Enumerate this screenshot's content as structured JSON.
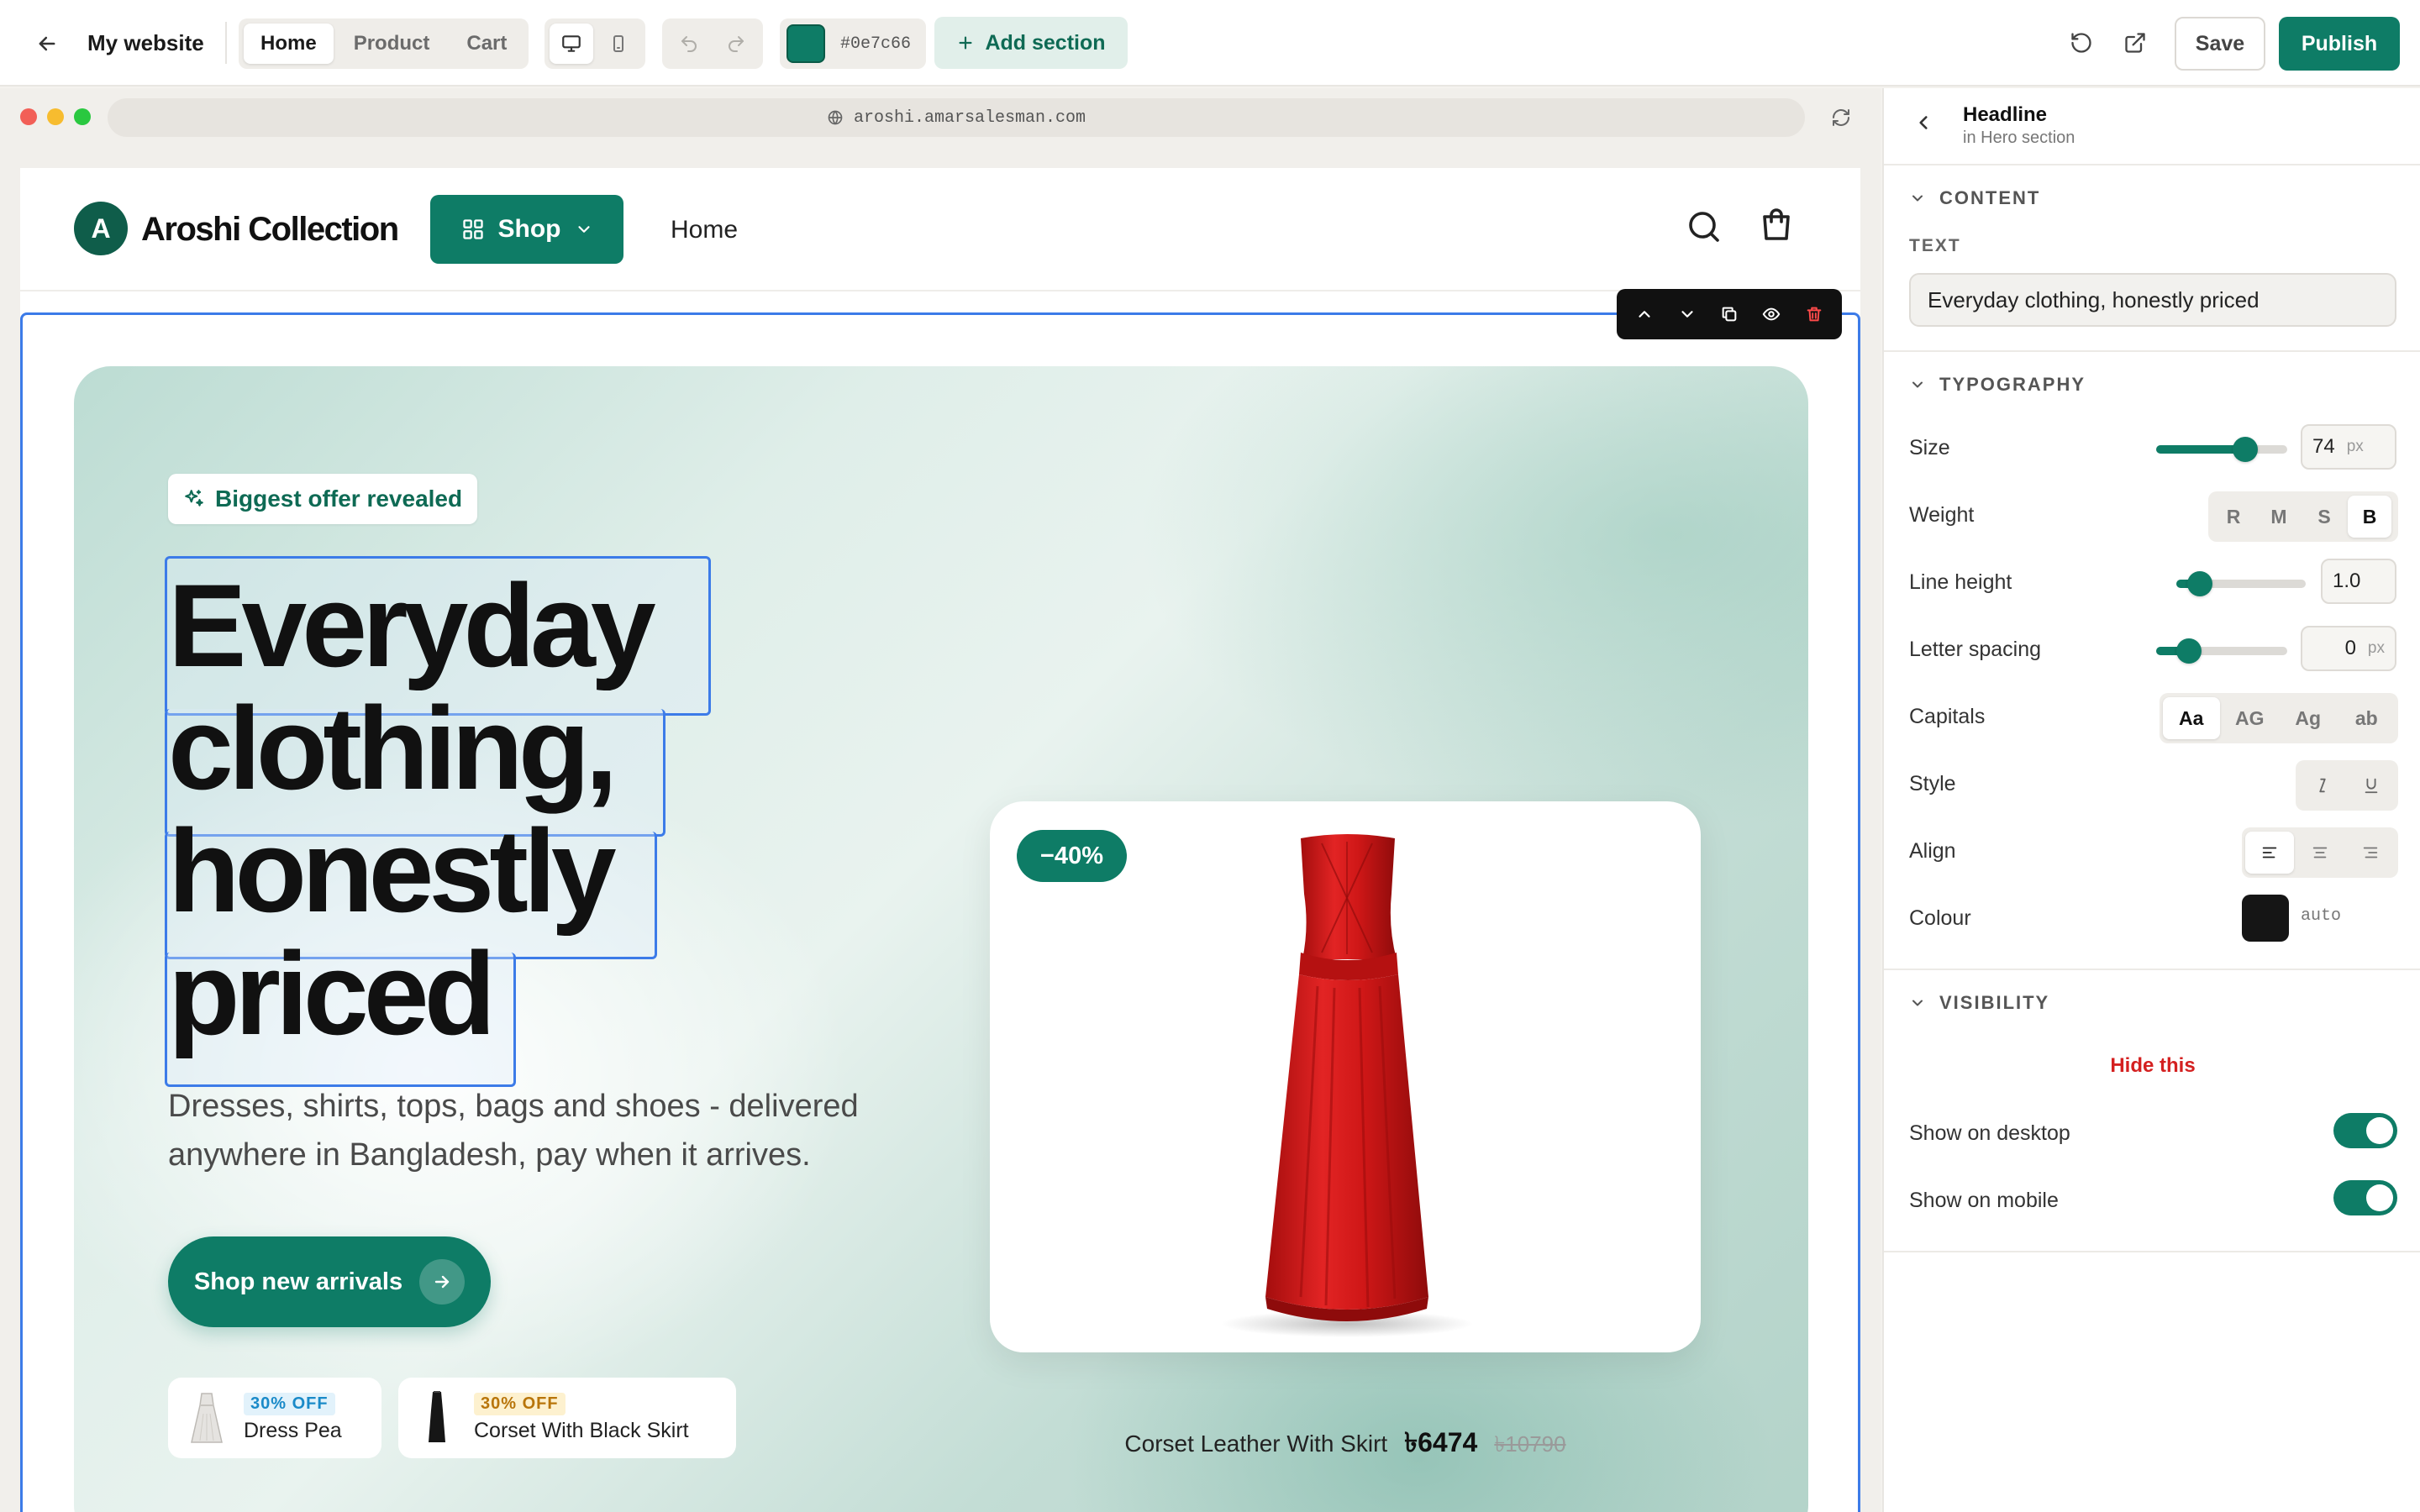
{
  "topbar": {
    "site_title": "My website",
    "pages": [
      "Home",
      "Product",
      "Cart"
    ],
    "active_page": "Home",
    "theme_color": "#0e7c66",
    "theme_hex": "#0e7c66",
    "add_section_label": "Add section",
    "save_label": "Save",
    "publish_label": "Publish"
  },
  "browser": {
    "url": "aroshi.amarsalesman.com"
  },
  "site": {
    "logo_letter": "A",
    "brand": "Aroshi Collection",
    "shop_label": "Shop",
    "nav_home": "Home",
    "hero": {
      "badge": "Biggest offer revealed",
      "headline_lines": [
        "Everyday",
        "clothing,",
        "honestly",
        "priced"
      ],
      "subtitle": "Dresses, shirts, tops, bags and shoes - delivered anywhere in Bangladesh, pay when it arrives.",
      "cta": "Shop new arrivals",
      "mini_cards": [
        {
          "discount": "30% OFF",
          "name": "Dress Pea"
        },
        {
          "discount": "30% OFF",
          "name": "Corset With Black Skirt"
        }
      ],
      "product": {
        "discount": "−40%",
        "name": "Corset Leather With Skirt",
        "price": "৳6474",
        "old_price": "৳10790"
      }
    }
  },
  "panel": {
    "title": "Headline",
    "subtitle": "in Hero section",
    "content_section": "CONTENT",
    "text_label": "TEXT",
    "text_value": "Everyday clothing, honestly priced",
    "typography_section": "TYPOGRAPHY",
    "size": {
      "label": "Size",
      "value": "74",
      "unit": "px",
      "fraction": 0.68
    },
    "weight": {
      "label": "Weight",
      "options": [
        "R",
        "M",
        "S",
        "B"
      ],
      "selected": "B"
    },
    "line_height": {
      "label": "Line height",
      "value": "1.0",
      "fraction": 0.18
    },
    "letter_spacing": {
      "label": "Letter spacing",
      "value": "0",
      "unit": "px",
      "fraction": 0.25
    },
    "capitals": {
      "label": "Capitals",
      "options": [
        "Aa",
        "AG",
        "Ag",
        "ab"
      ],
      "selected": "Aa"
    },
    "style_label": "Style",
    "align_label": "Align",
    "colour": {
      "label": "Colour",
      "value": "auto",
      "swatch": "#151515"
    },
    "visibility_section": "VISIBILITY",
    "hide_label": "Hide this",
    "show_desktop": {
      "label": "Show on desktop",
      "on": true
    },
    "show_mobile": {
      "label": "Show on mobile",
      "on": true
    }
  }
}
